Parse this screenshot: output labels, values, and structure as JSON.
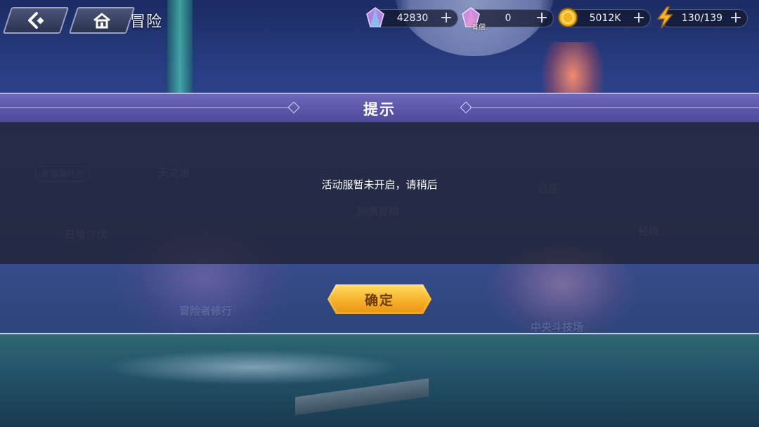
{
  "header": {
    "title": "冒险",
    "back_icon": "back-arrow-icon",
    "home_icon": "home-icon"
  },
  "resources": [
    {
      "name": "crystal",
      "icon": "crystal-icon",
      "value": "42830",
      "tag": ""
    },
    {
      "name": "paid-crystal",
      "icon": "paid-crystal-icon",
      "value": "0",
      "tag": "有偿"
    },
    {
      "name": "gold",
      "icon": "gold-coin-icon",
      "value": "5012K",
      "tag": ""
    },
    {
      "name": "stamina",
      "icon": "lightning-icon",
      "value": "130/139",
      "tag": ""
    }
  ],
  "map_labels": {
    "tower": "天之塔",
    "story": "剧情冒险",
    "expedition": "远征",
    "daily": "日常讨伐",
    "secret": "秘境",
    "training": "冒险者修行",
    "arena": "中央斗技场",
    "event": "奥德赛月光"
  },
  "dialog": {
    "title": "提示",
    "message": "活动服暂未开启，请稍后",
    "confirm_label": "确定"
  },
  "colors": {
    "header_band": "#5a55a8",
    "body_band": "#24283e",
    "confirm_button": "#f7b12b",
    "confirm_text": "#6b3a06"
  }
}
